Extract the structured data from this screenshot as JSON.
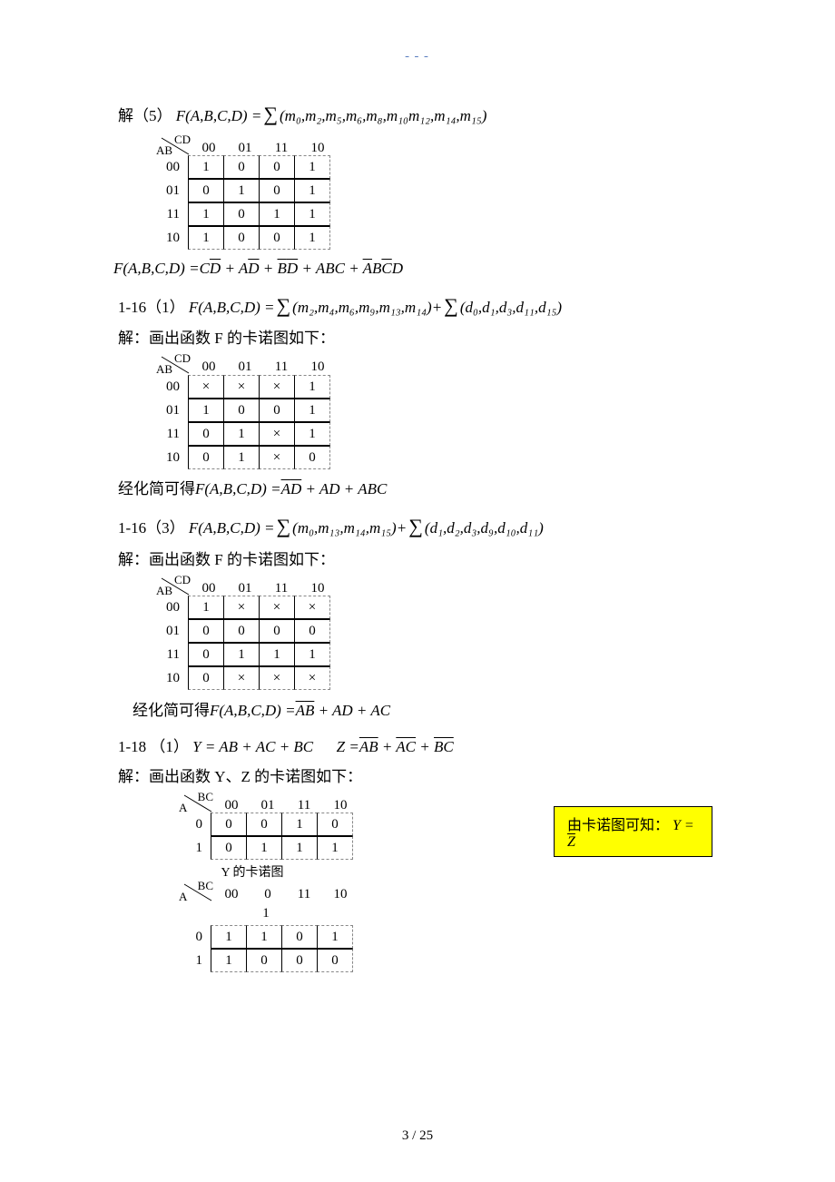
{
  "header_mark": "---",
  "p1": {
    "prefix": "解（5）",
    "lhs": "F(A,B,C,D) = ",
    "minterms": "(m₀,m₂,m₅,m₆,m₈,m₁₀m₁₂,m₁₄,m₁₅)"
  },
  "kmap1": {
    "row_var": "AB",
    "col_var": "CD",
    "cols": [
      "00",
      "01",
      "11",
      "10"
    ],
    "rows": [
      "00",
      "01",
      "11",
      "10"
    ],
    "cells": [
      [
        "1",
        "0",
        "0",
        "1"
      ],
      [
        "0",
        "1",
        "0",
        "1"
      ],
      [
        "1",
        "0",
        "1",
        "1"
      ],
      [
        "1",
        "0",
        "0",
        "1"
      ]
    ]
  },
  "p1_result_lhs": "F(A,B,C,D) = ",
  "p1_result_terms": [
    "C",
    "D̄",
    " + ",
    "A",
    "D̄",
    " + ",
    "B̄",
    "D̄",
    " + ",
    "ABC",
    " + ",
    "Ā",
    "B",
    "C̄",
    "D"
  ],
  "p1_result_raw": "F(A,B,C,D) = C D̄ + A D̄ + B̄ D̄ + ABC + Ā B C̄ D",
  "p2_head_prefix": "1-16（1）",
  "p2_head_lhs": "F(A,B,C,D) = ",
  "p2_minterms": "(m₂,m₄,m₆,m₉,m₁₃,m₁₄)",
  "p2_plus": " + ",
  "p2_dontcares": "(d₀,d₁,d₃,d₁₁,d₁₅)",
  "p2_note": "解：画出函数 F 的卡诺图如下：",
  "kmap2": {
    "row_var": "AB",
    "col_var": "CD",
    "cols": [
      "00",
      "01",
      "11",
      "10"
    ],
    "rows": [
      "00",
      "01",
      "11",
      "10"
    ],
    "cells": [
      [
        "×",
        "×",
        "×",
        "1"
      ],
      [
        "1",
        "0",
        "0",
        "1"
      ],
      [
        "0",
        "1",
        "×",
        "1"
      ],
      [
        "0",
        "1",
        "×",
        "0"
      ]
    ]
  },
  "p2_res_pref": "经化简可得",
  "p2_res_lhs": "F(A,B,C,D) = ",
  "p2_res_terms_raw": "ĀD̄ + AD + ABC",
  "p3_head_prefix": "1-16（3）",
  "p3_head_lhs": "F(A,B,C,D) = ",
  "p3_minterms": "(m₀,m₁₃,m₁₄,m₁₅)",
  "p3_plus": " + ",
  "p3_dontcares": "(d₁,d₂,d₃,d₉,d₁₀,d₁₁)",
  "p3_note": "解：画出函数 F 的卡诺图如下：",
  "kmap3": {
    "row_var": "AB",
    "col_var": "CD",
    "cols": [
      "00",
      "01",
      "11",
      "10"
    ],
    "rows": [
      "00",
      "01",
      "11",
      "10"
    ],
    "cells": [
      [
        "1",
        "×",
        "×",
        "×"
      ],
      [
        "0",
        "0",
        "0",
        "0"
      ],
      [
        "0",
        "1",
        "1",
        "1"
      ],
      [
        "0",
        "×",
        "×",
        "×"
      ]
    ]
  },
  "p3_res_pref": "经化简可得",
  "p3_res_lhs": "F(A,B,C,D) = ",
  "p3_res_terms_raw": "ĀB̄ + AD + AC",
  "p4_head_prefix": "1-18 （1）",
  "p4_Y_lhs": "Y = AB + AC + BC",
  "p4_spacer": "      ",
  "p4_Z_lhs": "Z = ",
  "p4_Z_terms_raw": "ĀB̄ + ĀC̄ + B̄C̄",
  "p4_Z_terms": [
    "AB",
    "AC",
    "BC"
  ],
  "p4_note": "解：画出函数 Y、Z 的卡诺图如下：",
  "kmapY": {
    "row_var": "A",
    "col_var": "BC",
    "cols": [
      "00",
      "01",
      "11",
      "10"
    ],
    "rows": [
      "0",
      "1"
    ],
    "cells": [
      [
        "0",
        "0",
        "1",
        "0"
      ],
      [
        "0",
        "1",
        "1",
        "1"
      ]
    ],
    "caption": "Y 的卡诺图"
  },
  "kmapZ": {
    "row_var": "A",
    "col_var": "BC",
    "cols": [
      "00",
      "0",
      "11",
      "10"
    ],
    "col_extra_row": [
      "",
      "1",
      "",
      ""
    ],
    "rows": [
      "0",
      "1"
    ],
    "cells": [
      [
        "1",
        "1",
        "0",
        "1"
      ],
      [
        "1",
        "0",
        "0",
        "0"
      ]
    ]
  },
  "note_box_pref": "由卡诺图可知：",
  "note_box_eq_lhs": "Y = ",
  "note_box_eq_rhs": "Z̄",
  "note_box_raw": "由卡诺图可知：Y = Z̄",
  "footer": "3  / 25"
}
